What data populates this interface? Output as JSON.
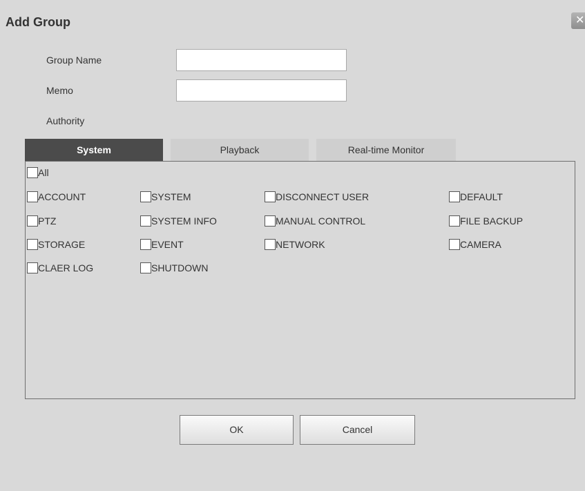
{
  "dialog": {
    "title": "Add Group",
    "close_icon_glyph": "✕"
  },
  "form": {
    "group_name_label": "Group Name",
    "group_name_value": "",
    "memo_label": "Memo",
    "memo_value": "",
    "authority_label": "Authority"
  },
  "tabs": [
    {
      "label": "System",
      "active": true
    },
    {
      "label": "Playback",
      "active": false
    },
    {
      "label": "Real-time Monitor",
      "active": false
    }
  ],
  "permissions": {
    "all": {
      "label": "All",
      "checked": false
    },
    "rows": [
      [
        {
          "label": "ACCOUNT",
          "checked": false
        },
        {
          "label": "SYSTEM",
          "checked": false
        },
        {
          "label": "DISCONNECT USER",
          "checked": false
        },
        {
          "label": "DEFAULT",
          "checked": false
        }
      ],
      [
        {
          "label": "PTZ",
          "checked": false
        },
        {
          "label": "SYSTEM INFO",
          "checked": false
        },
        {
          "label": "MANUAL CONTROL",
          "checked": false
        },
        {
          "label": "FILE BACKUP",
          "checked": false
        }
      ],
      [
        {
          "label": "STORAGE",
          "checked": false
        },
        {
          "label": "EVENT",
          "checked": false
        },
        {
          "label": "NETWORK",
          "checked": false
        },
        {
          "label": "CAMERA",
          "checked": false
        }
      ],
      [
        {
          "label": "CLAER LOG",
          "checked": false
        },
        {
          "label": "SHUTDOWN",
          "checked": false
        }
      ]
    ]
  },
  "buttons": {
    "ok_label": "OK",
    "cancel_label": "Cancel"
  },
  "colors": {
    "background": "#d9d9d9",
    "active_tab": "#4b4b4b",
    "inactive_tab": "#cfcfcf",
    "text": "#333333"
  }
}
